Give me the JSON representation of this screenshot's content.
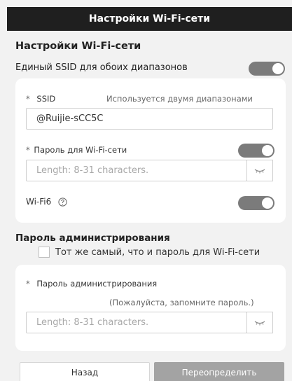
{
  "header": {
    "title": "Настройки Wi-Fi-сети"
  },
  "wifi": {
    "section_title": "Настройки Wi-Fi-сети",
    "unified_ssid_label": "Единый SSID для обоих диапазонов",
    "unified_ssid_on": true,
    "ssid": {
      "star": "*",
      "label": "SSID",
      "hint": "Используется двумя диапазонами",
      "value": "@Ruijie-sCC5C"
    },
    "password": {
      "star": "*",
      "label": "Пароль для Wi-Fi-сети",
      "toggle_on": true,
      "placeholder": "Length: 8-31 characters."
    },
    "wifi6": {
      "label": "Wi-Fi6",
      "toggle_on": true
    }
  },
  "admin": {
    "section_title": "Пароль администрирования",
    "same_as_wifi_label": "Тот же самый, что и пароль для Wi-Fi-сети",
    "same_as_wifi_checked": false,
    "password": {
      "star": "*",
      "label": "Пароль администрирования",
      "hint": "(Пожалуйста, запомните пароль.)",
      "placeholder": "Length: 8-31 characters."
    }
  },
  "footer": {
    "back_label": "Назад",
    "override_label": "Переопределить"
  },
  "colors": {
    "header_bg": "#1f1f1f",
    "toggle_on": "#7b7b7b",
    "primary_disabled": "#a3a3a3"
  },
  "icons": {
    "eye": "eye-closed-icon",
    "help": "question-circle-icon"
  }
}
